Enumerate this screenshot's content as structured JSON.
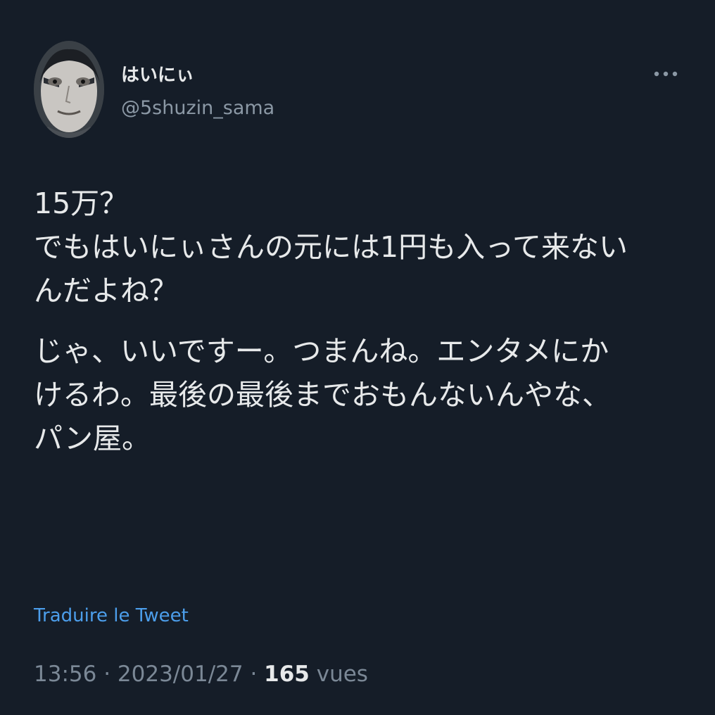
{
  "author": {
    "display_name": "はいにぃ",
    "handle": "@5shuzin_sama"
  },
  "header": {
    "more_icon": "more-horizontal-icon"
  },
  "tweet": {
    "paragraphs": [
      "15万？\nでもはいにぃさんの元には1円も入って来ない\nんだよね？",
      "じゃ、いいですー。つまんね。エンタメにか\nけるわ。最後の最後までおもんないんやな、\nパン屋。"
    ],
    "translate_label": "Traduire le Tweet"
  },
  "meta": {
    "time": "13:56",
    "separator1": " · ",
    "date": "2023/01/27",
    "separator2": " · ",
    "views_count": "165",
    "views_label": " vues"
  },
  "colors": {
    "background": "#151d28",
    "text_primary": "#e7e9ea",
    "text_secondary": "#8b98a5",
    "link": "#4c9eeb"
  }
}
